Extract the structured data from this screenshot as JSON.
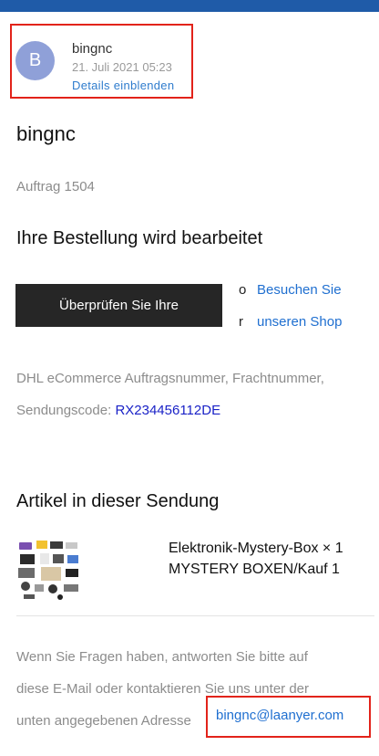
{
  "sender": {
    "avatar_letter": "B",
    "name": "bingnc",
    "date": "21. Juli 2021 05:23",
    "details_link": "Details einblenden"
  },
  "shop_name": "bingnc",
  "order_number": "Auftrag 1504",
  "headline": "Ihre Bestellung wird bearbeitet",
  "review_button": "Überprüfen Sie Ihre",
  "visit_shop": {
    "bullet_1": "o",
    "line_1": "Besuchen Sie",
    "bullet_2": "r",
    "line_2": "unseren Shop"
  },
  "tracking": {
    "text_line_1": "DHL eCommerce Auftragsnummer, Frachtnummer,",
    "label": "Sendungscode:",
    "code": "RX234456112DE"
  },
  "items_section_title": "Artikel in dieser Sendung",
  "item": {
    "title": "Elektronik-Mystery-Box × 1",
    "subtitle": "MYSTERY BOXEN/Kauf 1"
  },
  "footer": {
    "line_1": "Wenn Sie Fragen haben, antworten Sie bitte auf",
    "line_2": "diese E-Mail oder kontaktieren Sie uns unter der",
    "line_3": "unten angegebenen Adresse",
    "email": "bingnc@laanyer.com"
  },
  "colors": {
    "top_bar": "#1f5ba8",
    "highlight_border": "#e2231a",
    "link": "#1f6fd0",
    "tracking_code": "#1a22c7",
    "button_bg": "#262626",
    "avatar_bg": "#8fa0d8"
  }
}
